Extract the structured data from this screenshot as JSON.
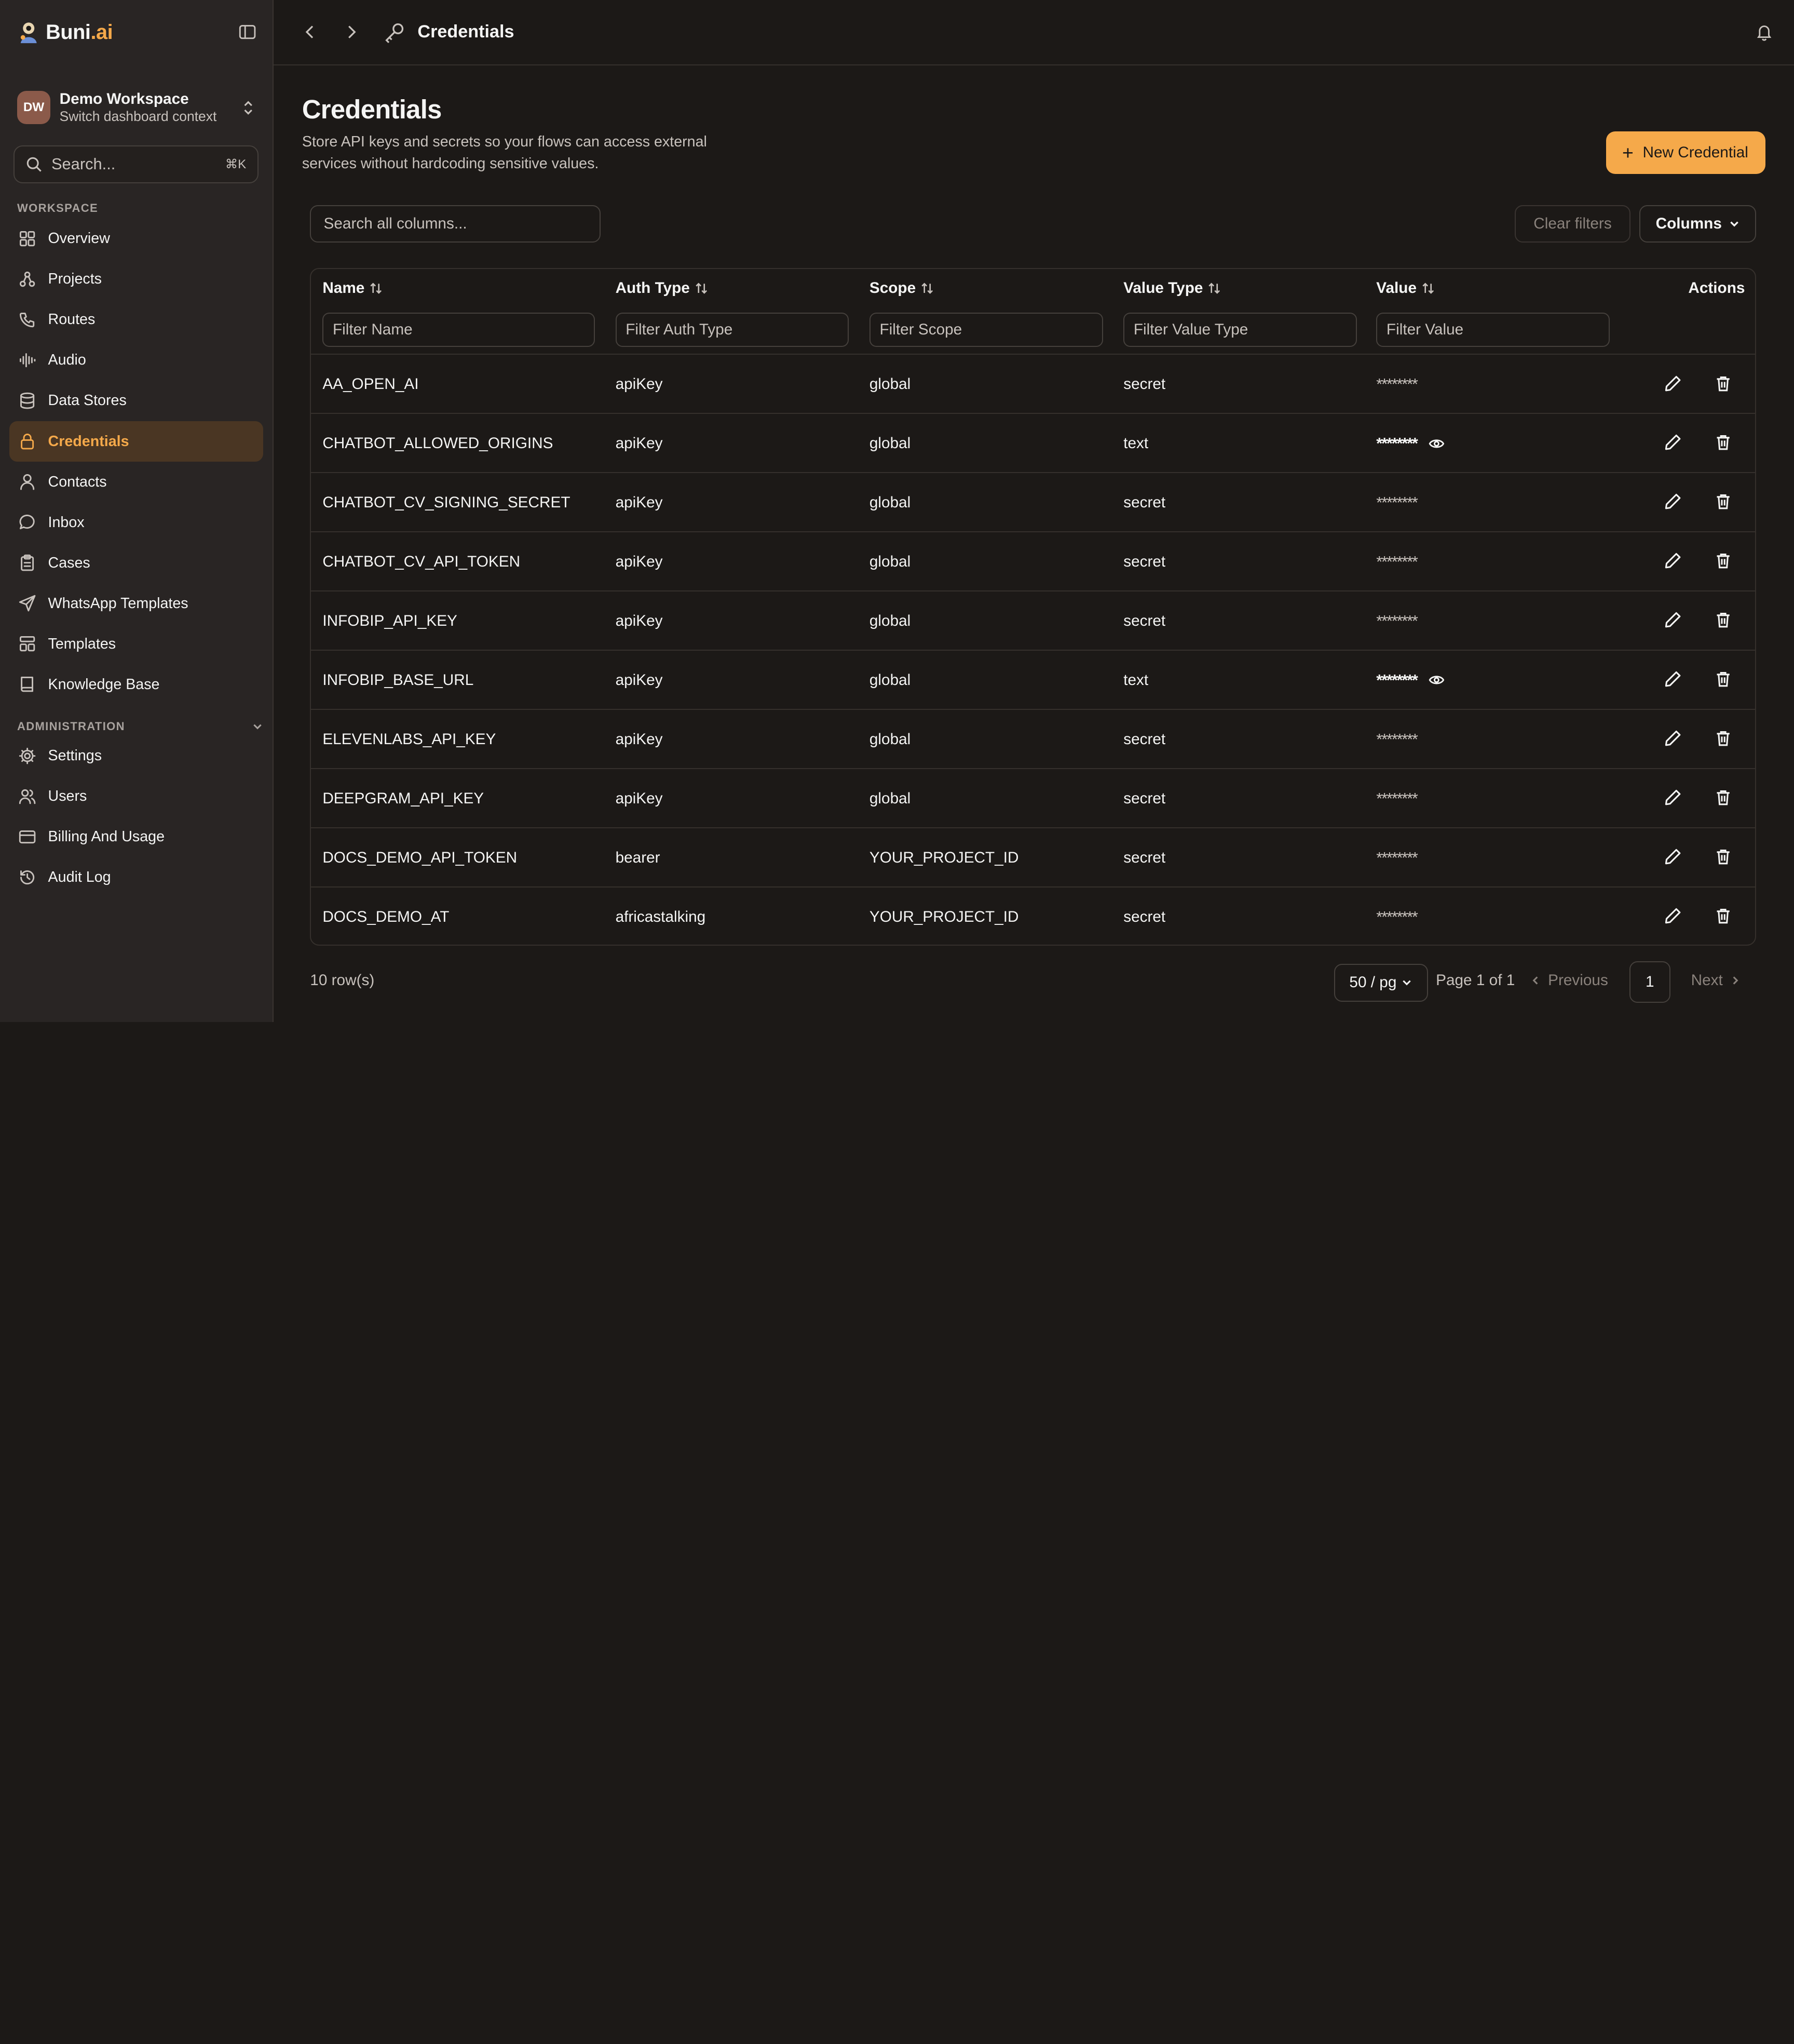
{
  "app": {
    "brand_main": "Buni",
    "brand_accent": ".ai"
  },
  "workspace": {
    "initials": "DW",
    "name": "Demo Workspace",
    "subtitle": "Switch dashboard context"
  },
  "sidebar_search": {
    "placeholder": "Search...",
    "shortcut": "⌘K"
  },
  "sections": {
    "workspace": "WORKSPACE",
    "administration": "ADMINISTRATION"
  },
  "nav_workspace": [
    {
      "label": "Overview",
      "icon": "grid-icon"
    },
    {
      "label": "Projects",
      "icon": "projects-icon"
    },
    {
      "label": "Routes",
      "icon": "phone-icon"
    },
    {
      "label": "Audio",
      "icon": "audio-wave-icon"
    },
    {
      "label": "Data Stores",
      "icon": "database-icon"
    },
    {
      "label": "Credentials",
      "icon": "lock-icon",
      "active": true
    },
    {
      "label": "Contacts",
      "icon": "user-icon"
    },
    {
      "label": "Inbox",
      "icon": "chat-bubble-icon"
    },
    {
      "label": "Cases",
      "icon": "clipboard-icon"
    },
    {
      "label": "WhatsApp Templates",
      "icon": "send-icon"
    },
    {
      "label": "Templates",
      "icon": "layout-icon"
    },
    {
      "label": "Knowledge Base",
      "icon": "book-icon"
    }
  ],
  "nav_admin": [
    {
      "label": "Settings",
      "icon": "gear-icon"
    },
    {
      "label": "Users",
      "icon": "users-icon"
    },
    {
      "label": "Billing And Usage",
      "icon": "credit-card-icon"
    },
    {
      "label": "Audit Log",
      "icon": "history-icon"
    }
  ],
  "topbar": {
    "title": "Credentials"
  },
  "page": {
    "title": "Credentials",
    "description": "Store API keys and secrets so your flows can access external services without hardcoding sensitive values.",
    "new_button": "New Credential"
  },
  "toolbar": {
    "search_placeholder": "Search all columns...",
    "clear_filters": "Clear filters",
    "columns": "Columns"
  },
  "table": {
    "columns": [
      "Name",
      "Auth Type",
      "Scope",
      "Value Type",
      "Value",
      "Actions"
    ],
    "filters": [
      "Filter Name",
      "Filter Auth Type",
      "Filter Scope",
      "Filter Value Type",
      "Filter Value"
    ],
    "rows": [
      {
        "name": "AA_OPEN_AI",
        "auth": "apiKey",
        "scope": "global",
        "vtype": "secret",
        "value": "********",
        "revealable": false
      },
      {
        "name": "CHATBOT_ALLOWED_ORIGINS",
        "auth": "apiKey",
        "scope": "global",
        "vtype": "text",
        "value": "********",
        "revealable": true
      },
      {
        "name": "CHATBOT_CV_SIGNING_SECRET",
        "auth": "apiKey",
        "scope": "global",
        "vtype": "secret",
        "value": "********",
        "revealable": false
      },
      {
        "name": "CHATBOT_CV_API_TOKEN",
        "auth": "apiKey",
        "scope": "global",
        "vtype": "secret",
        "value": "********",
        "revealable": false
      },
      {
        "name": "INFOBIP_API_KEY",
        "auth": "apiKey",
        "scope": "global",
        "vtype": "secret",
        "value": "********",
        "revealable": false
      },
      {
        "name": "INFOBIP_BASE_URL",
        "auth": "apiKey",
        "scope": "global",
        "vtype": "text",
        "value": "********",
        "revealable": true
      },
      {
        "name": "ELEVENLABS_API_KEY",
        "auth": "apiKey",
        "scope": "global",
        "vtype": "secret",
        "value": "********",
        "revealable": false
      },
      {
        "name": "DEEPGRAM_API_KEY",
        "auth": "apiKey",
        "scope": "global",
        "vtype": "secret",
        "value": "********",
        "revealable": false
      },
      {
        "name": "DOCS_DEMO_API_TOKEN",
        "auth": "bearer",
        "scope": "YOUR_PROJECT_ID",
        "vtype": "secret",
        "value": "********",
        "revealable": false
      },
      {
        "name": "DOCS_DEMO_AT",
        "auth": "africastalking",
        "scope": "YOUR_PROJECT_ID",
        "vtype": "secret",
        "value": "********",
        "revealable": false
      }
    ]
  },
  "footer": {
    "row_count": "10 row(s)",
    "page_size": "50 / pg",
    "page_info": "Page 1 of 1",
    "previous": "Previous",
    "page_number": "1",
    "next": "Next"
  },
  "colors": {
    "accent": "#f5a94a",
    "background": "#1c1917",
    "sidebar": "#292524",
    "active_bg": "#4a3623"
  }
}
